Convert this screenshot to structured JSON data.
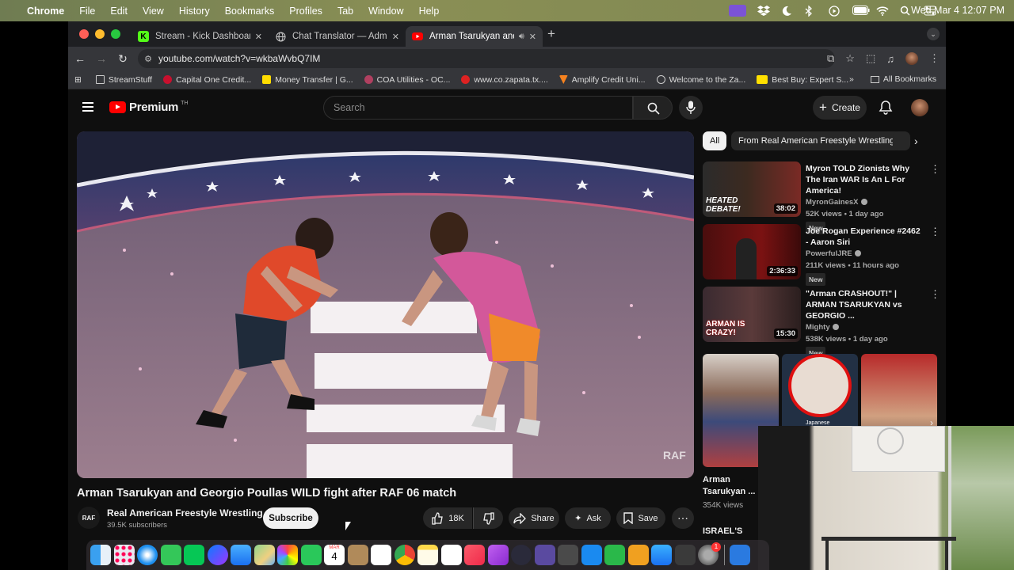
{
  "menubar": {
    "app": "Chrome",
    "items": [
      "File",
      "Edit",
      "View",
      "History",
      "Bookmarks",
      "Profiles",
      "Tab",
      "Window",
      "Help"
    ],
    "clock": "Wed Mar 4  12:07 PM"
  },
  "tabs": [
    {
      "title": "Stream - Kick Dashboard",
      "favicon": "K"
    },
    {
      "title": "Chat Translator — Admin",
      "favicon": "globe"
    },
    {
      "title": "Arman Tsarukyan and Ge",
      "favicon": "youtube"
    }
  ],
  "url": "youtube.com/watch?v=wkbaWvbQ7IM",
  "bookmarks": [
    "StreamStuff",
    "Capital One Credit...",
    "Money Transfer | G...",
    "COA Utilities - OC...",
    "www.co.zapata.tx....",
    "Amplify Credit Uni...",
    "Welcome to the Za...",
    "Best Buy: Expert S..."
  ],
  "bookmarks_all": "All Bookmarks",
  "youtube": {
    "logo_word": "Premium",
    "logo_sup": "TH",
    "search_placeholder": "Search",
    "create_label": "Create"
  },
  "video": {
    "overlay_text": "RAF",
    "title": "Arman Tsarukyan and Georgio Poullas WILD fight after RAF 06 match",
    "channel": "Real American Freestyle Wrestling",
    "channel_avatar": "RAF",
    "subscribers": "39.5K subscribers",
    "subscribe_label": "Subscribe",
    "likes": "18K",
    "share_label": "Share",
    "ask_label": "Ask",
    "save_label": "Save"
  },
  "chips": [
    "All",
    "From Real American Freestyle Wrestling"
  ],
  "recommendations": [
    {
      "title": "Myron TOLD Zionists Why The Iran WAR Is An L For America!",
      "channel": "MyronGainesX",
      "meta": "52K views • 1 day ago",
      "badge": "New",
      "duration": "38:02",
      "thumb_text": "HEATED DEBATE!"
    },
    {
      "title": "Joe Rogan Experience #2462 - Aaron Siri",
      "channel": "PowerfulJRE",
      "meta": "211K views • 11 hours ago",
      "badge": "New",
      "duration": "2:36:33",
      "thumb_text": ""
    },
    {
      "title": "\"Arman CRASHOUT!\" | ARMAN TSARUKYAN vs GEORGIO ...",
      "channel": "Mighty",
      "meta": "538K views • 1 day ago",
      "badge": "New",
      "duration": "15:30",
      "thumb_text": "ARMAN IS CRAZY!"
    }
  ],
  "shorts": {
    "first_title": "Arman Tsarukyan ...",
    "first_views": "354K views",
    "second_caption": "Japanese",
    "partial_title": "ISRAEL'S"
  },
  "dock_badges": {
    "calendar_month": "MAR",
    "calendar_day": "4",
    "settings_badge": "1"
  }
}
